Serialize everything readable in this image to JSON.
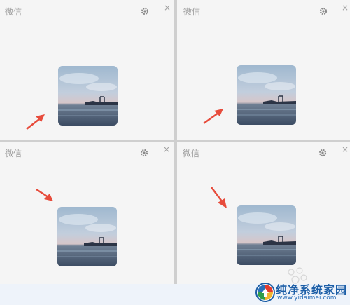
{
  "panels": [
    {
      "title": "微信",
      "close": "×",
      "icons": [
        "gear-icon",
        "close-icon"
      ]
    },
    {
      "title": "微信",
      "close": "×",
      "icons": [
        "gear-icon",
        "close-icon"
      ]
    },
    {
      "title": "微信",
      "close": "×",
      "icons": [
        "gear-icon",
        "close-icon"
      ]
    },
    {
      "title": "微信",
      "close": "×",
      "icons": [
        "gear-icon",
        "close-icon"
      ]
    }
  ],
  "avatar": {
    "description_icon": "seascape-avatar"
  },
  "annotation": {
    "arrow_color": "#e74c3c",
    "icon": "red-arrow-icon"
  },
  "watermark": {
    "title": "纯净系统家园",
    "url": "www.yidaimei.com"
  },
  "colors": {
    "panel_bg": "#f5f5f5",
    "divider": "#cfcfcf",
    "title_text": "#9c9c9c",
    "watermark_blue": "#1c5ea6"
  }
}
